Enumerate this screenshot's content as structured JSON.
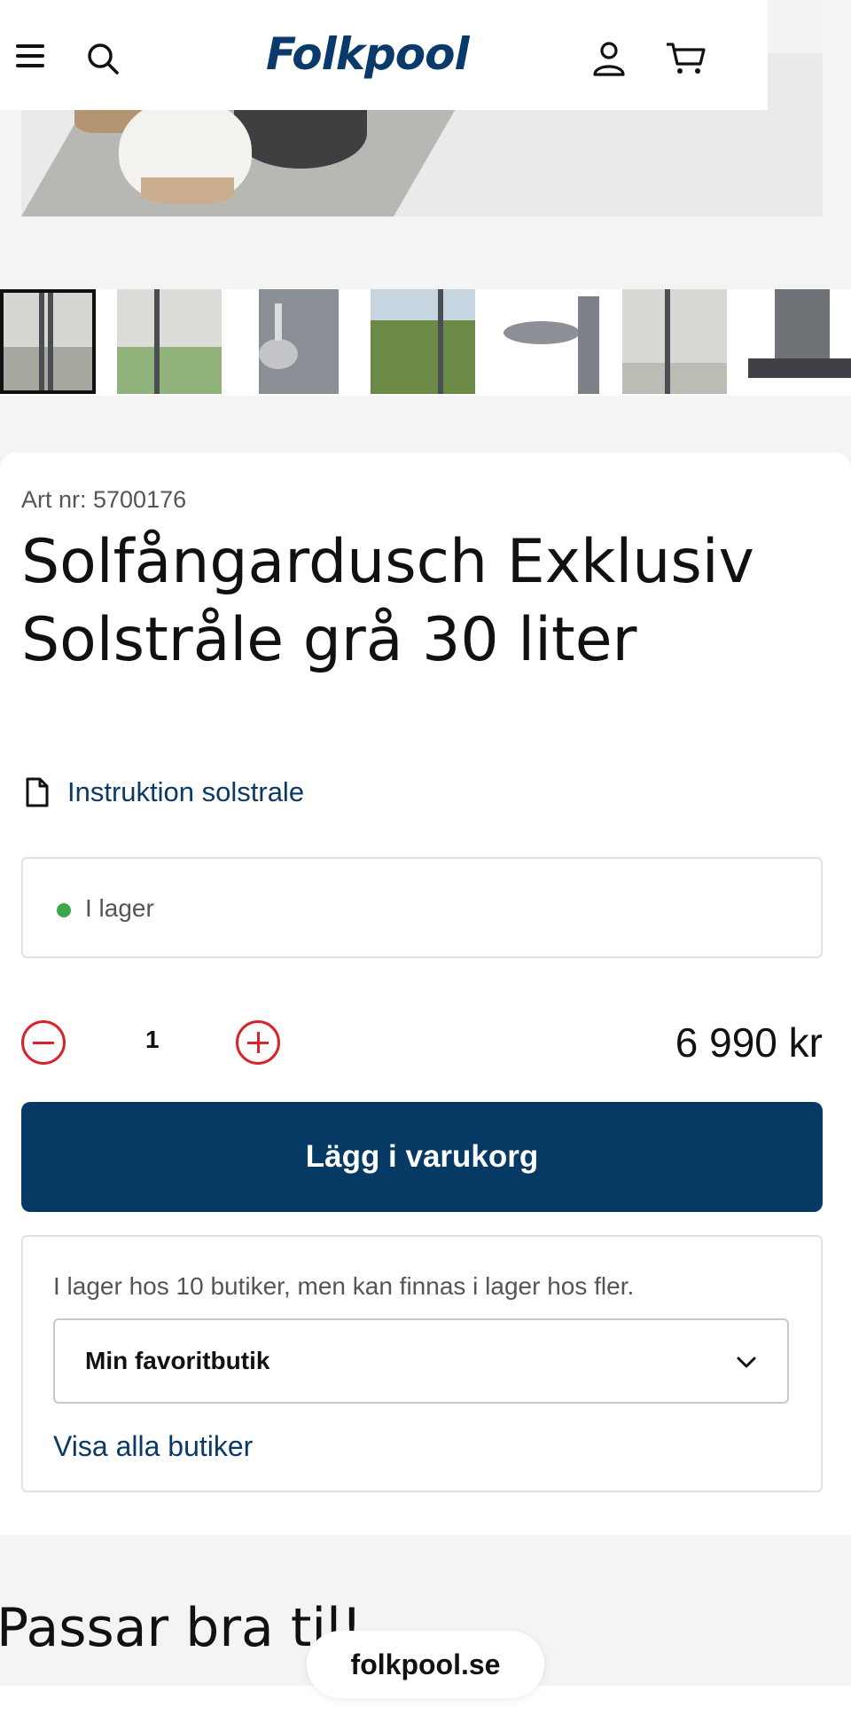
{
  "header": {
    "logo_text": "Folkpool",
    "icons": [
      "menu-icon",
      "search-icon",
      "user-icon",
      "cart-icon"
    ]
  },
  "product": {
    "art_nr": "Art nr: 5700176",
    "title": "Solfångardusch Exklusiv Solstråle grå 30 liter",
    "document_link": "Instruktion solstrale",
    "stock_status": "I lager",
    "stock_color": "#3aa84b",
    "quantity": "1",
    "price": "6 990 kr",
    "add_to_cart_label": "Lägg i varukorg",
    "accent_color": "#063a64"
  },
  "stores": {
    "info": "I lager hos 10 butiker, men kan finnas i lager hos fler.",
    "selected_store": "Min favoritbutik",
    "show_all_label": "Visa alla butiker"
  },
  "related": {
    "heading": "Passar bra til!"
  },
  "footer": {
    "site_label": "folkpool.se"
  }
}
